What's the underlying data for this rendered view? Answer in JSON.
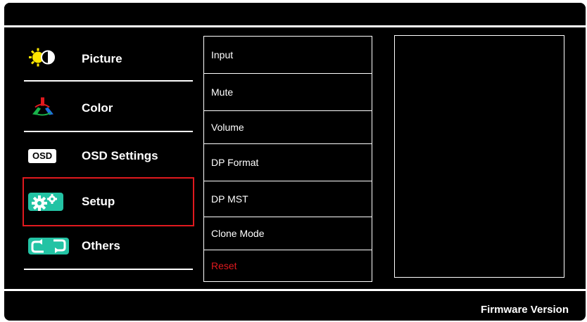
{
  "menu": {
    "items": [
      {
        "label": "Picture",
        "icon": "picture-brightness-icon"
      },
      {
        "label": "Color",
        "icon": "color-rgb-icon"
      },
      {
        "label": "OSD Settings",
        "icon": "osd-badge-icon",
        "badge": "OSD"
      },
      {
        "label": "Setup",
        "icon": "setup-gears-icon",
        "selected": true
      },
      {
        "label": "Others",
        "icon": "others-arrows-icon"
      }
    ]
  },
  "submenu": {
    "items": [
      {
        "label": "Input"
      },
      {
        "label": "Mute"
      },
      {
        "label": "Volume"
      },
      {
        "label": "DP Format"
      },
      {
        "label": "DP MST"
      },
      {
        "label": "Clone Mode"
      },
      {
        "label": "Reset",
        "color": "#e0191e"
      }
    ]
  },
  "footer": {
    "firmware_label": "Firmware Version"
  },
  "colors": {
    "background": "#000000",
    "text": "#ffffff",
    "selection": "#e0191e",
    "accent": "#23c3a4"
  }
}
